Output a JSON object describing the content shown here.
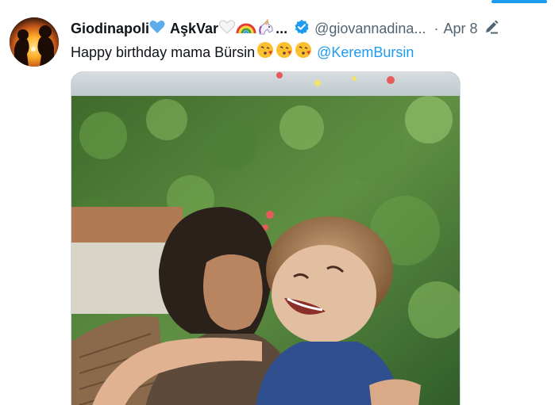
{
  "tweet": {
    "display_name": "Giodinapoli",
    "name_suffix_1": "AşkVar",
    "name_ellipsis": "...",
    "handle": "@giovannadina...",
    "separator": "·",
    "date": "Apr 8",
    "text": "Happy birthday mama  Bürsin",
    "mention": "@KeremBursin",
    "icons": {
      "verified": "verified-badge-icon",
      "edit": "edit-pencil-icon",
      "blue_heart": "blue-heart-icon",
      "white_heart": "white-heart-icon",
      "rainbow": "rainbow-icon",
      "unicorn": "unicorn-icon",
      "kiss": "face-blowing-kiss-icon"
    }
  },
  "colors": {
    "link": "#1d9bf0",
    "text": "#0f1419",
    "secondary": "#536471",
    "accent_bar": "#1d9bf0"
  }
}
